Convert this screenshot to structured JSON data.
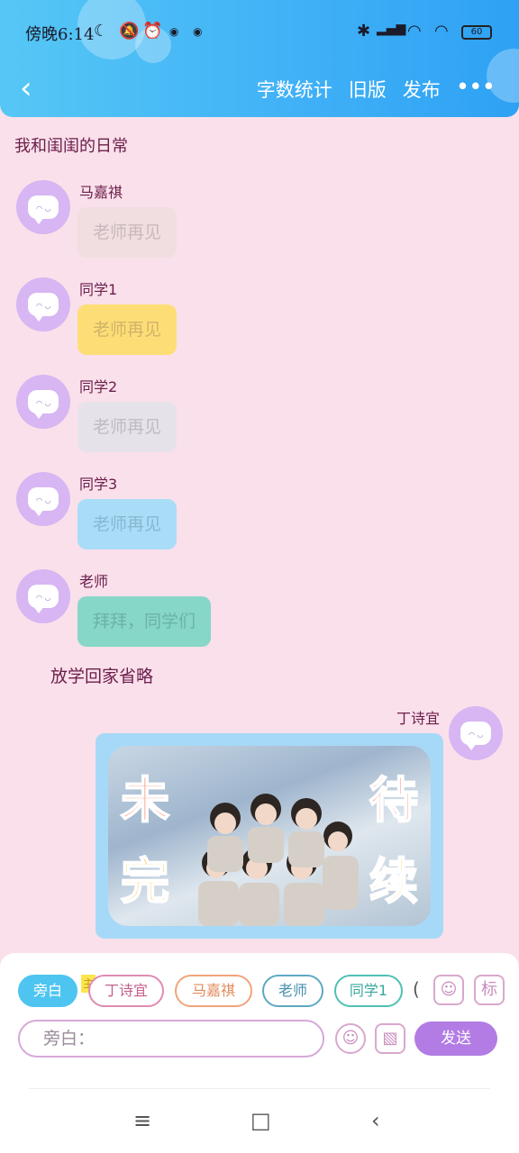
{
  "status_bar": {
    "time": "傍晚6:14",
    "battery": "60"
  },
  "header": {
    "back_icon": "chevron-left-icon",
    "actions": [
      "字数统计",
      "旧版",
      "发布"
    ],
    "more_icon": "more-dots-icon"
  },
  "chat": {
    "title": "我和闺闺的日常",
    "messages": [
      {
        "sender": "马嘉祺",
        "text": "老师再见",
        "bubble_color": "#f1dee1",
        "text_color": "#c9b9bc"
      },
      {
        "sender": "同学1",
        "text": "老师再见",
        "bubble_color": "#fdde76",
        "text_color": "#d0b46a"
      },
      {
        "sender": "同学2",
        "text": "老师再见",
        "bubble_color": "#e6e2ea",
        "text_color": "#bfbbc6"
      },
      {
        "sender": "同学3",
        "text": "老师再见",
        "bubble_color": "#a9dcf6",
        "text_color": "#86b8d3"
      },
      {
        "sender": "老师",
        "text": "拜拜，同学们",
        "bubble_color": "#86d7c7",
        "text_color": "#6bb3a5"
      }
    ],
    "narration": "放学回家省略",
    "image_message": {
      "sender": "丁诗宜",
      "caption_left": [
        "未",
        "完"
      ],
      "caption_right": [
        "待",
        "续"
      ]
    }
  },
  "composer": {
    "chips": [
      {
        "label": "旁白",
        "active": true
      },
      {
        "label": "丁诗宜",
        "active": false
      },
      {
        "label": "马嘉祺",
        "active": false
      },
      {
        "label": "老师",
        "active": false
      },
      {
        "label": "同学1",
        "active": false
      }
    ],
    "chip_badge": "主",
    "overflow_paren": "(",
    "tag_label": "标",
    "input_placeholder": "旁白：",
    "send_label": "发送"
  },
  "system_nav": {
    "menu": "≡",
    "home": "□",
    "back": "‹"
  },
  "colors": {
    "header": "#3fb0f6",
    "background": "#fae0ea",
    "accent": "#b27ce4"
  }
}
